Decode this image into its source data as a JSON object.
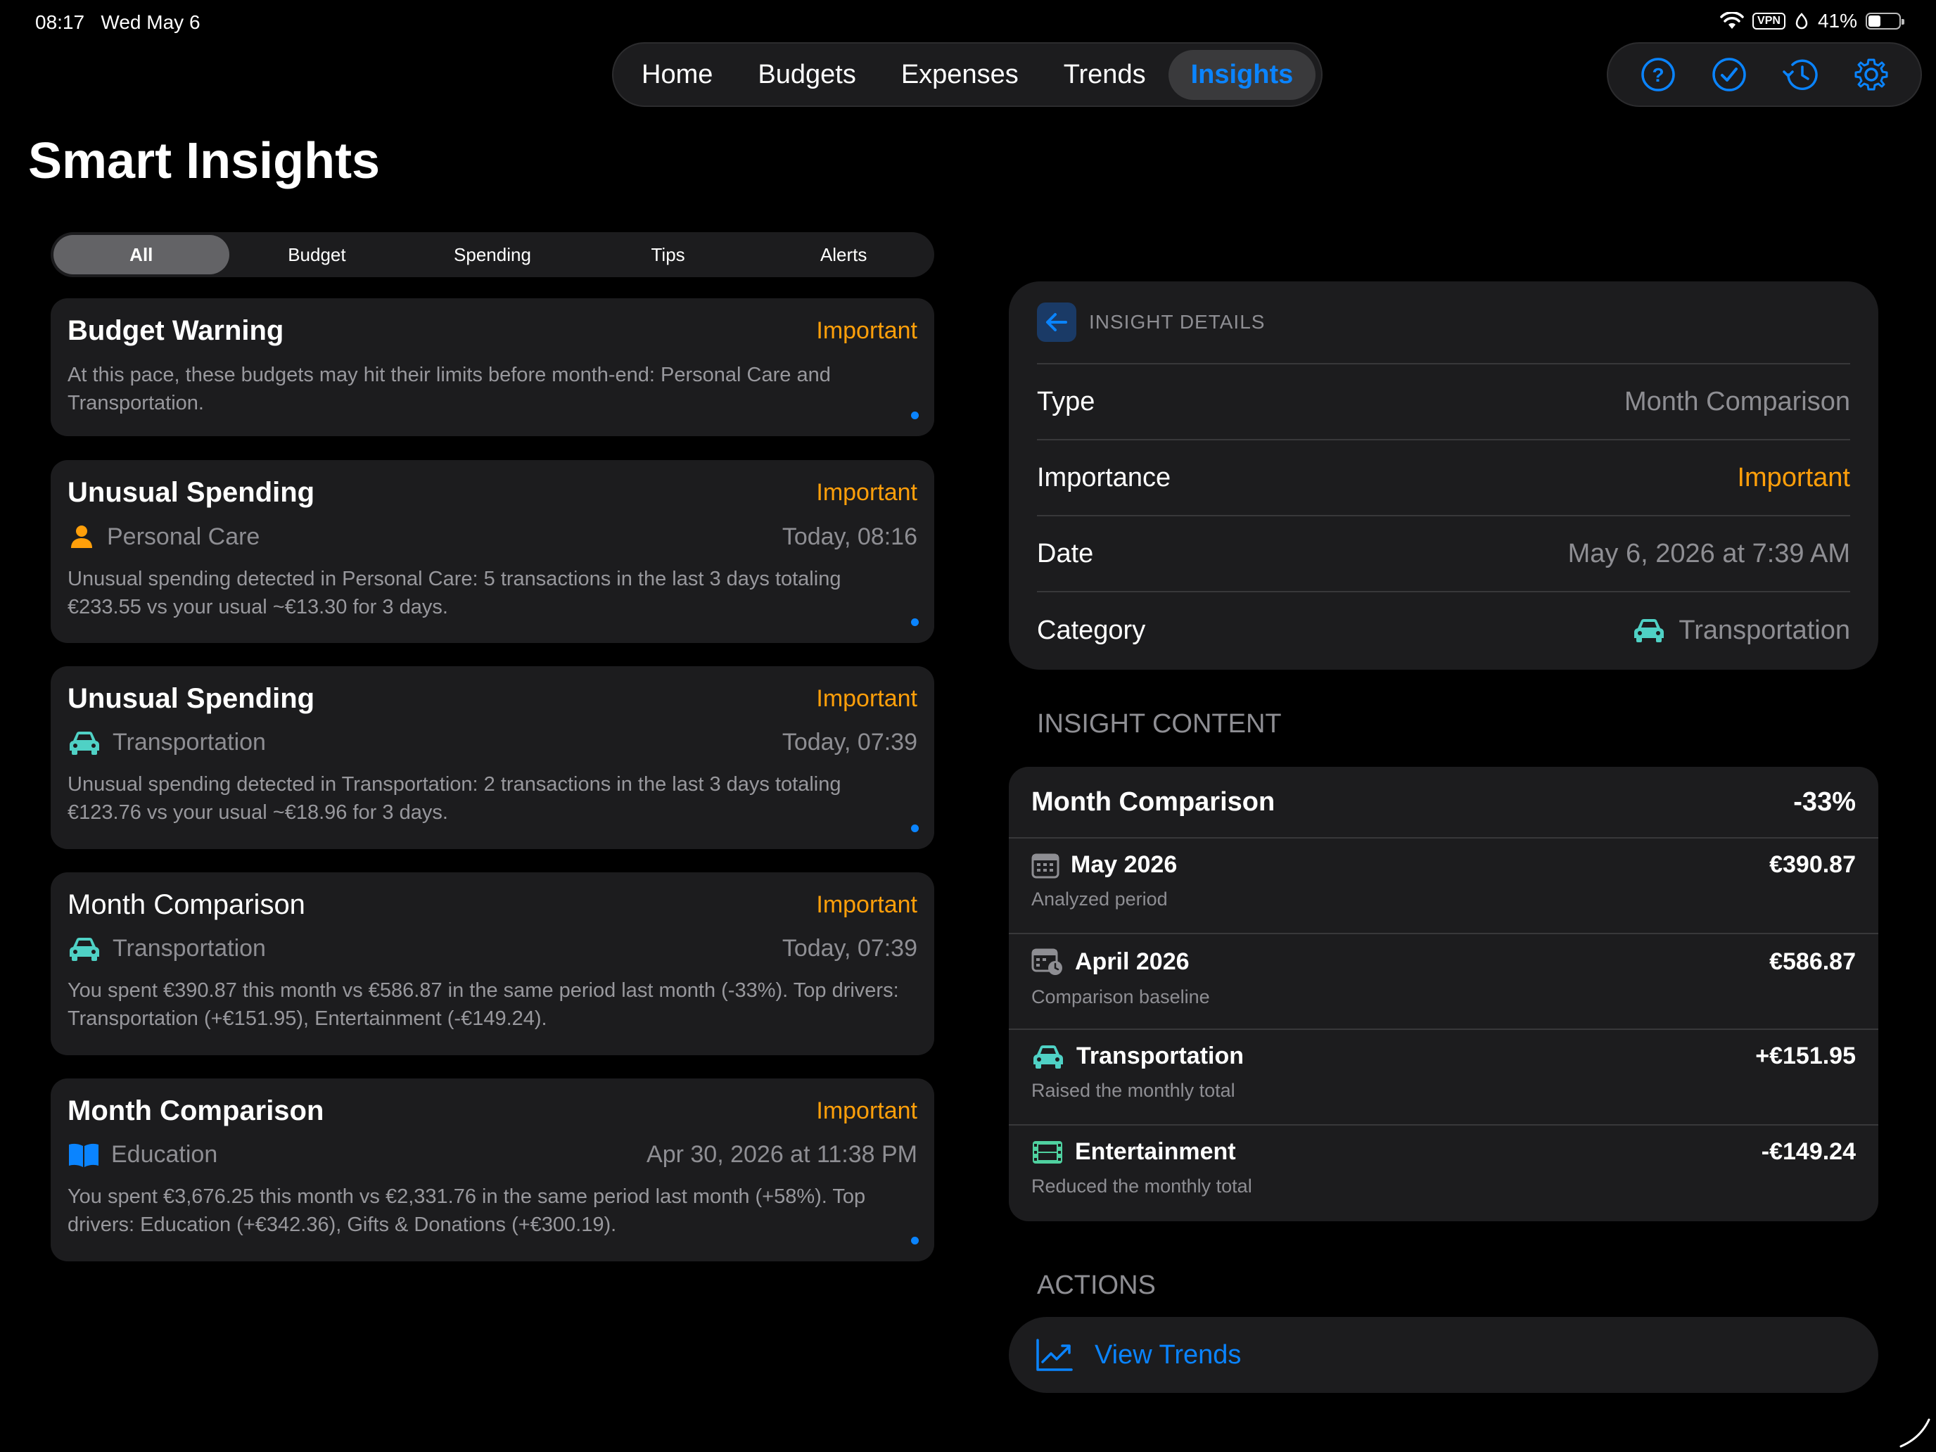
{
  "status_bar": {
    "time": "08:17",
    "date": "Wed May 6",
    "vpn": "VPN",
    "battery": "41%",
    "battery_level": 0.41
  },
  "nav": {
    "tabs": [
      {
        "label": "Home"
      },
      {
        "label": "Budgets"
      },
      {
        "label": "Expenses"
      },
      {
        "label": "Trends"
      },
      {
        "label": "Insights",
        "active": true
      }
    ]
  },
  "toolbar": {
    "icons": [
      "help-icon",
      "checkmark-circle-icon",
      "history-icon",
      "gear-icon"
    ]
  },
  "page_title": "Smart Insights",
  "filters": {
    "options": [
      "All",
      "Budget",
      "Spending",
      "Tips",
      "Alerts"
    ],
    "selected": "All"
  },
  "insights": [
    {
      "title": "Budget Warning",
      "importance": "Important",
      "body": "At this pace, these budgets may hit their limits before month-end: Personal Care and Transportation.",
      "unread": true
    },
    {
      "title": "Unusual Spending",
      "importance": "Important",
      "category": "Personal Care",
      "category_icon": "person-icon",
      "time": "Today, 08:16",
      "body": "Unusual spending detected in Personal Care: 5 transactions in the last 3 days totaling €233.55 vs your usual ~€13.30 for 3 days.",
      "unread": true
    },
    {
      "title": "Unusual Spending",
      "importance": "Important",
      "category": "Transportation",
      "category_icon": "car-icon",
      "time": "Today, 07:39",
      "body": "Unusual spending detected in Transportation: 2 transactions in the last 3 days totaling €123.76 vs your usual ~€18.96 for 3 days.",
      "unread": true
    },
    {
      "title": "Month Comparison",
      "importance": "Important",
      "category": "Transportation",
      "category_icon": "car-icon",
      "time": "Today, 07:39",
      "body": "You spent €390.87 this month vs €586.87 in the same period last month (-33%). Top drivers: Transportation (+€151.95), Entertainment (-€149.24).",
      "unread": false,
      "selected": true
    },
    {
      "title": "Month Comparison",
      "importance": "Important",
      "category": "Education",
      "category_icon": "book-icon",
      "time": "Apr 30, 2026 at 11:38 PM",
      "body": "You spent €3,676.25 this month vs €2,331.76 in the same period last month (+58%). Top drivers: Education (+€342.36), Gifts & Donations (+€300.19).",
      "unread": true
    }
  ],
  "details": {
    "header": "INSIGHT DETAILS",
    "type_label": "Type",
    "type_value": "Month Comparison",
    "importance_label": "Importance",
    "importance_value": "Important",
    "date_label": "Date",
    "date_value": "May 6, 2026 at 7:39 AM",
    "category_label": "Category",
    "category_value": "Transportation"
  },
  "content": {
    "section_label": "INSIGHT CONTENT",
    "title": "Month Comparison",
    "change": "-33%",
    "rows": [
      {
        "title": "May 2026",
        "sub": "Analyzed period",
        "amount": "€390.87",
        "icon": "calendar-icon"
      },
      {
        "title": "April 2026",
        "sub": "Comparison baseline",
        "amount": "€586.87",
        "icon": "calendar-clock-icon"
      },
      {
        "title": "Transportation",
        "sub": "Raised the monthly total",
        "amount": "+€151.95",
        "icon": "car-icon"
      },
      {
        "title": "Entertainment",
        "sub": "Reduced the monthly total",
        "amount": "-€149.24",
        "icon": "film-icon"
      }
    ]
  },
  "actions": {
    "section_label": "ACTIONS",
    "view_trends": "View Trends"
  },
  "colors": {
    "accent": "#0a84ff",
    "important": "#ff9f0a",
    "teal": "#4fd1c5",
    "personal_care": "#ff9f0a",
    "education": "#0a84ff"
  }
}
